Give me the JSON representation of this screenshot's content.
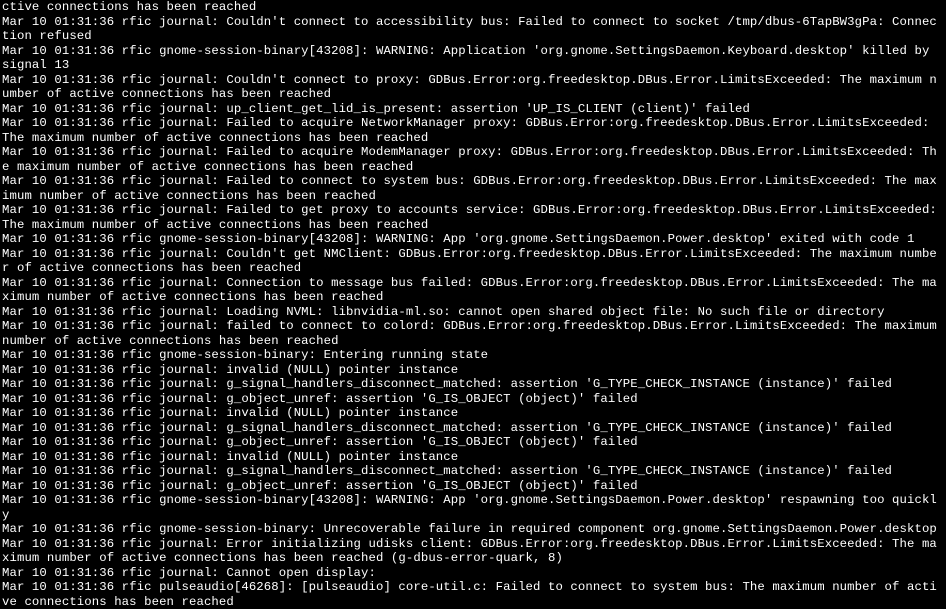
{
  "terminal": {
    "lines": [
      "ctive connections has been reached",
      "Mar 10 01:31:36 rfic journal: Couldn't connect to accessibility bus: Failed to connect to socket /tmp/dbus-6TapBW3gPa: Connection refused",
      "Mar 10 01:31:36 rfic gnome-session-binary[43208]: WARNING: Application 'org.gnome.SettingsDaemon.Keyboard.desktop' killed by signal 13",
      "Mar 10 01:31:36 rfic journal: Couldn't connect to proxy: GDBus.Error:org.freedesktop.DBus.Error.LimitsExceeded: The maximum number of active connections has been reached",
      "Mar 10 01:31:36 rfic journal: up_client_get_lid_is_present: assertion 'UP_IS_CLIENT (client)' failed",
      "Mar 10 01:31:36 rfic journal: Failed to acquire NetworkManager proxy: GDBus.Error:org.freedesktop.DBus.Error.LimitsExceeded: The maximum number of active connections has been reached",
      "Mar 10 01:31:36 rfic journal: Failed to acquire ModemManager proxy: GDBus.Error:org.freedesktop.DBus.Error.LimitsExceeded: The maximum number of active connections has been reached",
      "Mar 10 01:31:36 rfic journal: Failed to connect to system bus: GDBus.Error:org.freedesktop.DBus.Error.LimitsExceeded: The maximum number of active connections has been reached",
      "Mar 10 01:31:36 rfic journal: Failed to get proxy to accounts service: GDBus.Error:org.freedesktop.DBus.Error.LimitsExceeded: The maximum number of active connections has been reached",
      "Mar 10 01:31:36 rfic gnome-session-binary[43208]: WARNING: App 'org.gnome.SettingsDaemon.Power.desktop' exited with code 1",
      "Mar 10 01:31:36 rfic journal: Couldn't get NMClient: GDBus.Error:org.freedesktop.DBus.Error.LimitsExceeded: The maximum number of active connections has been reached",
      "Mar 10 01:31:36 rfic journal: Connection to message bus failed: GDBus.Error:org.freedesktop.DBus.Error.LimitsExceeded: The maximum number of active connections has been reached",
      "Mar 10 01:31:36 rfic journal: Loading NVML: libnvidia-ml.so: cannot open shared object file: No such file or directory",
      "Mar 10 01:31:36 rfic journal: failed to connect to colord: GDBus.Error:org.freedesktop.DBus.Error.LimitsExceeded: The maximum number of active connections has been reached",
      "Mar 10 01:31:36 rfic gnome-session-binary: Entering running state",
      "Mar 10 01:31:36 rfic journal: invalid (NULL) pointer instance",
      "Mar 10 01:31:36 rfic journal: g_signal_handlers_disconnect_matched: assertion 'G_TYPE_CHECK_INSTANCE (instance)' failed",
      "Mar 10 01:31:36 rfic journal: g_object_unref: assertion 'G_IS_OBJECT (object)' failed",
      "Mar 10 01:31:36 rfic journal: invalid (NULL) pointer instance",
      "Mar 10 01:31:36 rfic journal: g_signal_handlers_disconnect_matched: assertion 'G_TYPE_CHECK_INSTANCE (instance)' failed",
      "Mar 10 01:31:36 rfic journal: g_object_unref: assertion 'G_IS_OBJECT (object)' failed",
      "Mar 10 01:31:36 rfic journal: invalid (NULL) pointer instance",
      "Mar 10 01:31:36 rfic journal: g_signal_handlers_disconnect_matched: assertion 'G_TYPE_CHECK_INSTANCE (instance)' failed",
      "Mar 10 01:31:36 rfic journal: g_object_unref: assertion 'G_IS_OBJECT (object)' failed",
      "Mar 10 01:31:36 rfic gnome-session-binary[43208]: WARNING: App 'org.gnome.SettingsDaemon.Power.desktop' respawning too quickly",
      "Mar 10 01:31:36 rfic gnome-session-binary: Unrecoverable failure in required component org.gnome.SettingsDaemon.Power.desktop",
      "Mar 10 01:31:36 rfic journal: Error initializing udisks client: GDBus.Error:org.freedesktop.DBus.Error.LimitsExceeded: The maximum number of active connections has been reached (g-dbus-error-quark, 8)",
      "Mar 10 01:31:36 rfic journal: Cannot open display:",
      "Mar 10 01:31:36 rfic pulseaudio[46268]: [pulseaudio] core-util.c: Failed to connect to system bus: The maximum number of active connections has been reached"
    ]
  }
}
